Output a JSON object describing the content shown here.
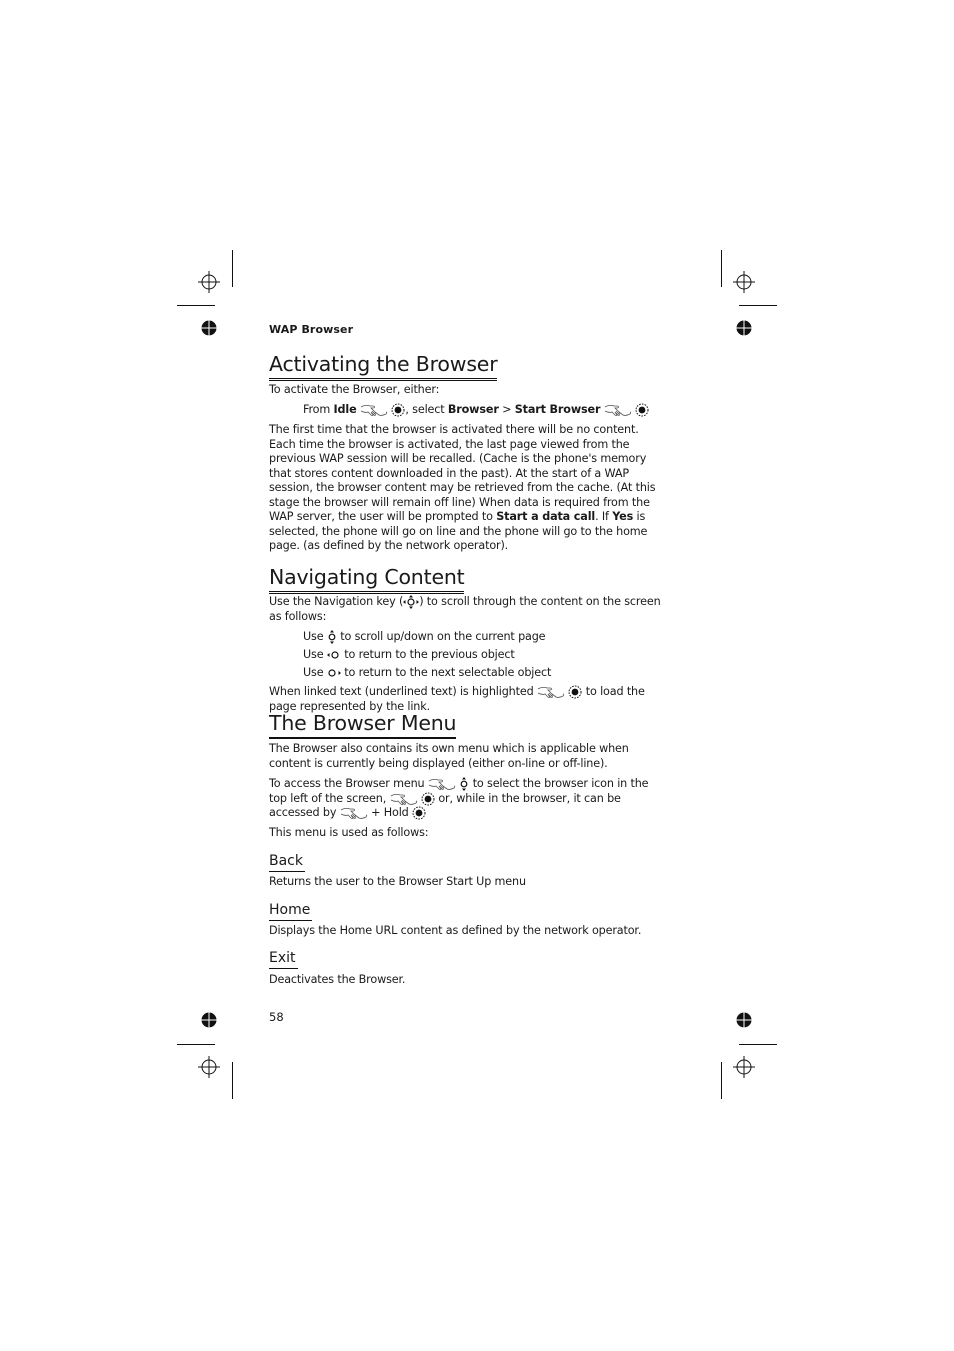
{
  "running_head": "WAP Browser",
  "page_number": "58",
  "sections": {
    "activating": {
      "title": "Activating the Browser",
      "intro": "To activate the Browser, either:",
      "step": {
        "from": "From",
        "idle": "Idle",
        "select": ", select",
        "browser": "Browser",
        "arrow": ">",
        "start_browser": "Start Browser"
      },
      "body_1": "The first time that the browser is activated there will be no content.  Each time the browser is activated, the last page viewed from the previous WAP session will be recalled. (Cache is the phone's memory that stores content downloaded in the past). At the start of a WAP session, the browser content may be retrieved from the cache. (At this stage the browser will remain off line) When data is required from the WAP server, the user will be prompted to",
      "start_data_call": "Start a data call",
      "body_2": ". If",
      "yes": "Yes",
      "body_3": "is selected, the phone will go on line and the phone will go to the home page. (as defined by the network operator)."
    },
    "navigating": {
      "title": "Navigating Content",
      "intro_1": "Use the Navigation key (",
      "intro_2": ") to scroll through the content on the screen as follows:",
      "items": [
        {
          "use": "Use",
          "text": "to scroll up/down on the current page",
          "icon": "nav-up-down-icon"
        },
        {
          "use": "Use",
          "text": "to return to the previous object",
          "icon": "nav-left-icon"
        },
        {
          "use": "Use",
          "text": "to return to the next selectable object",
          "icon": "nav-right-icon"
        }
      ],
      "linked_1": "When linked text (underlined text) is highlighted",
      "linked_2": "to load the page represented by the link."
    },
    "menu": {
      "title": "The Browser Menu",
      "body_1": "The Browser also contains its own menu which is applicable when content is currently being displayed (either on-line or off-line).",
      "access_1": "To access the Browser menu",
      "access_2": "to select the browser icon in the top left of the screen,",
      "access_3": "or, while in the browser, it can be accessed by",
      "access_4": "+ Hold",
      "usage": "This menu is used as follows:",
      "options": [
        {
          "title": "Back",
          "desc": "Returns the user to the Browser Start Up menu"
        },
        {
          "title": "Home",
          "desc": "Displays the Home URL content as defined by the network operator."
        },
        {
          "title": "Exit",
          "desc": "Deactivates the Browser."
        }
      ]
    }
  }
}
